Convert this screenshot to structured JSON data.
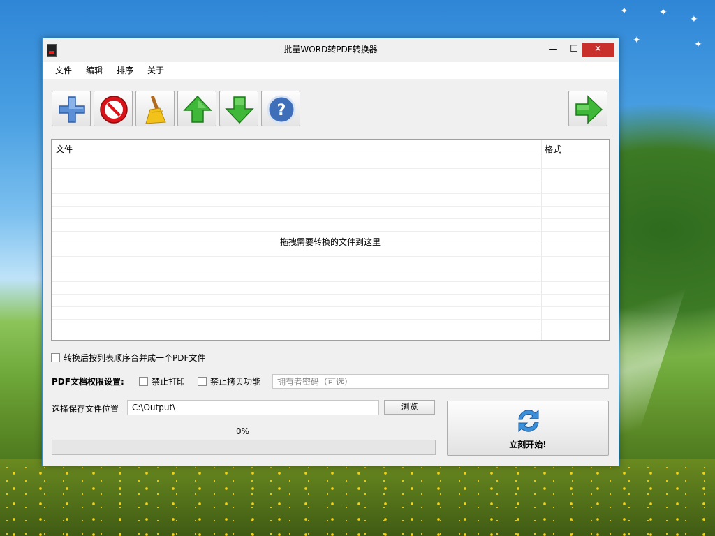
{
  "window": {
    "title": "批量WORD转PDF转换器",
    "minimize_glyph": "—",
    "maximize_glyph": "☐",
    "close_glyph": "✕"
  },
  "menu": [
    "文件",
    "编辑",
    "排序",
    "关于"
  ],
  "toolbar": {
    "buttons": [
      "add-icon",
      "remove-icon",
      "clear-broom-icon",
      "move-up-icon",
      "move-down-icon",
      "help-icon"
    ],
    "next_button": "next-arrow-icon"
  },
  "filelist": {
    "columns": [
      "文件",
      "格式"
    ],
    "drop_hint": "拖拽需要转换的文件到这里"
  },
  "options": {
    "merge_label": "转换后按列表顺序合并成一个PDF文件",
    "merge_checked": false
  },
  "permissions": {
    "heading": "PDF文档权限设置:",
    "disable_print_label": "禁止打印",
    "disable_print_checked": false,
    "disable_copy_label": "禁止拷贝功能",
    "disable_copy_checked": false,
    "owner_password_placeholder": "拥有者密码（可选）",
    "owner_password_value": ""
  },
  "output": {
    "label": "选择保存文件位置",
    "path": "C:\\Output\\",
    "browse_label": "浏览"
  },
  "progress": {
    "text": "0%",
    "value": 0
  },
  "start_button": {
    "label": "立刻开始!"
  },
  "colors": {
    "accent": "#3b8cc8",
    "close_button": "#c9302c",
    "progress_fill": "#06b025"
  }
}
